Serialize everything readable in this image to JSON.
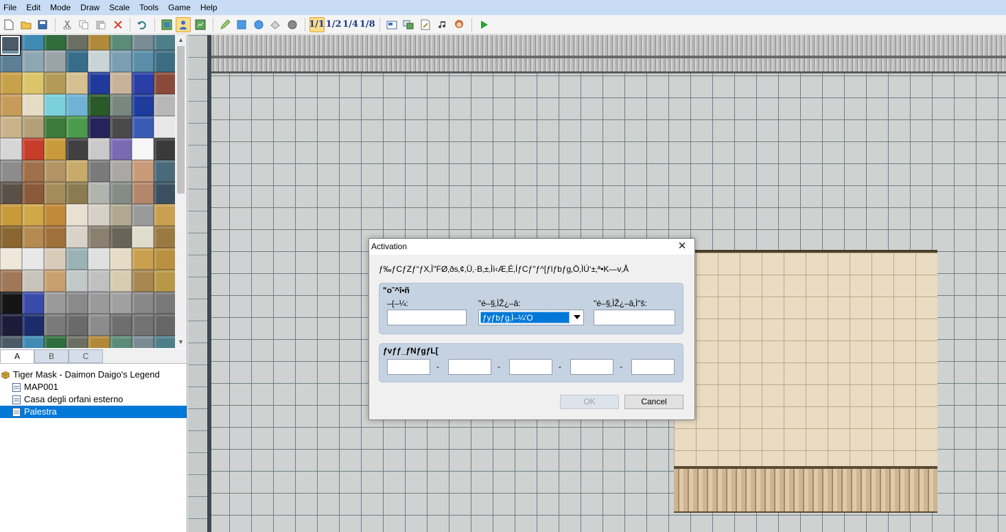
{
  "menu": [
    "File",
    "Edit",
    "Mode",
    "Draw",
    "Scale",
    "Tools",
    "Game",
    "Help"
  ],
  "toolbar": {
    "icons": [
      "new-project-icon",
      "open-project-icon",
      "save-project-icon",
      "cut-icon",
      "copy-icon",
      "paste-icon",
      "delete-icon",
      "undo-icon",
      "map-layer-icon",
      "event-layer-icon",
      "region-layer-icon",
      "pencil-icon",
      "rectangle-icon",
      "ellipse-icon",
      "fill-icon",
      "shadow-pen-icon",
      "zoom-1-1-icon",
      "zoom-1-2-icon",
      "zoom-1-4-icon",
      "zoom-1-8-icon",
      "database-icon",
      "resource-manager-icon",
      "script-editor-icon",
      "sound-test-icon",
      "character-generator-icon",
      "playtest-icon"
    ],
    "zoom_labels": [
      "1/1",
      "1/2",
      "1/4",
      "1/8"
    ]
  },
  "tileset_tabs": [
    "A",
    "B",
    "C"
  ],
  "map_tree": {
    "project": "Tiger Mask - Daimon Daigo's Legend",
    "maps": [
      "MAP001",
      "Casa degli orfani esterno",
      "Palestra"
    ],
    "selected": "Palestra"
  },
  "dialog": {
    "title": "Activation",
    "description": "ƒ‰ƒCƒZƒ“ƒX‚Ì\"FØ‚ðs‚¢‚Ü‚·B‚±‚Ìì‹Æ‚É‚ÍƒCƒ\"ƒ^[ƒlƒbƒg‚Ö‚ÌÚ‘±‚ª•K—v‚Å",
    "user_group": {
      "title": "\"o˜^î•ñ",
      "name_label": "–{–¼:",
      "payment_label": "\"é–§‚ÌŽ¿–â:",
      "payment_value": "ƒyƒbƒg‚Ì–¼'O",
      "answer_label": "\"é–§‚ÌŽ¿–â‚Ì\"š:",
      "name_value": "",
      "answer_value": ""
    },
    "product_group": {
      "title": "ƒvƒƒ_ƒNƒgƒL[",
      "separator": "-",
      "keys": [
        "",
        "",
        "",
        "",
        ""
      ]
    },
    "ok_label": "OK",
    "cancel_label": "Cancel"
  }
}
